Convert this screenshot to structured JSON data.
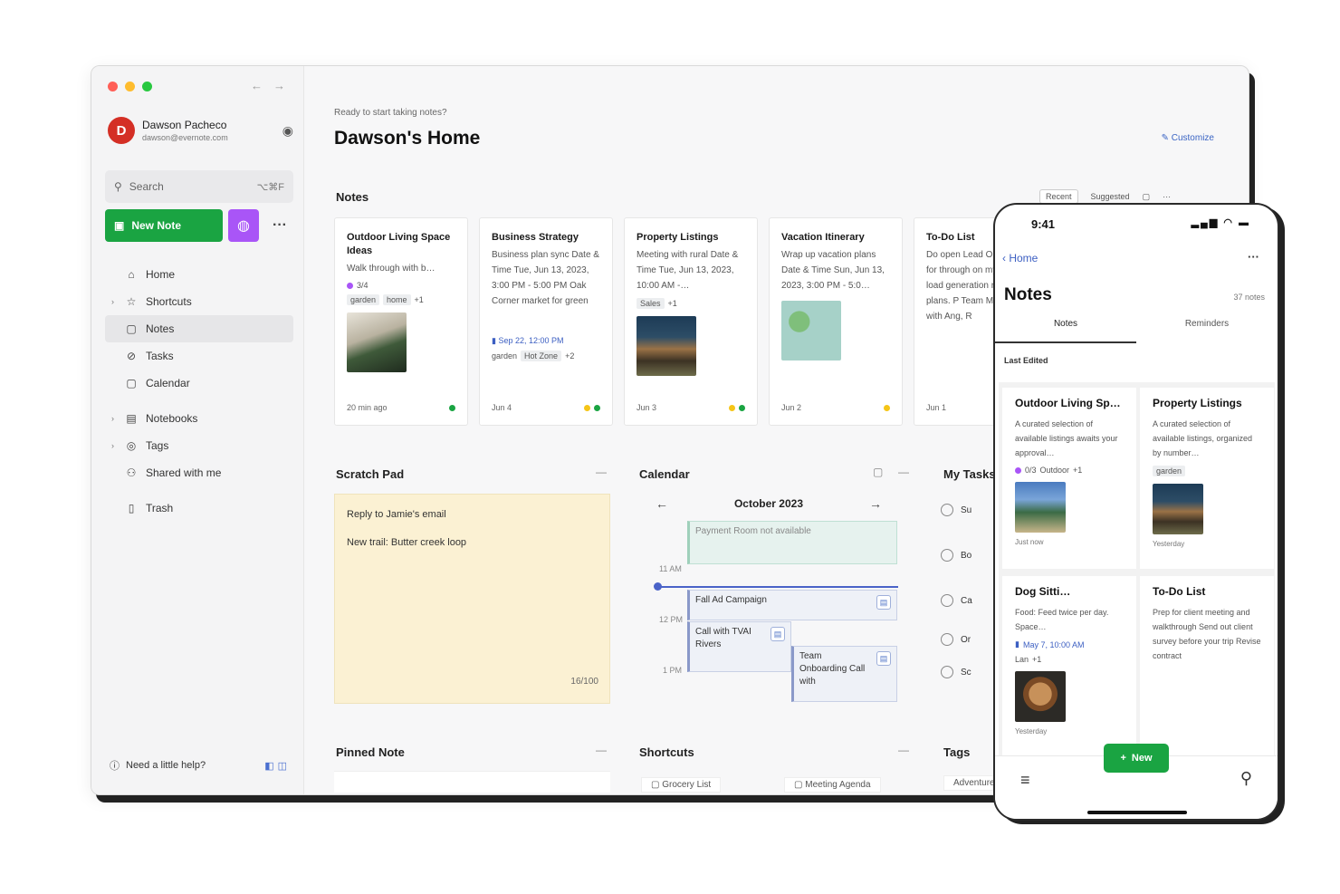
{
  "window": {
    "account_name": "Dawson Pacheco",
    "account_email": "dawson@evernote.com",
    "search_placeholder": "Search",
    "search_shortcut": "⌥⌘F",
    "new_note_label": "New Note",
    "nav": [
      {
        "label": "Home",
        "icon": "home-icon"
      },
      {
        "label": "Shortcuts",
        "icon": "star-icon"
      },
      {
        "label": "Notes",
        "icon": "note-icon"
      },
      {
        "label": "Tasks",
        "icon": "check-circle-icon"
      },
      {
        "label": "Calendar",
        "icon": "calendar-icon"
      },
      {
        "label": "Notebooks",
        "icon": "notebook-icon"
      },
      {
        "label": "Tags",
        "icon": "tag-icon"
      },
      {
        "label": "Shared with me",
        "icon": "people-icon"
      },
      {
        "label": "Trash",
        "icon": "trash-icon"
      }
    ],
    "help_label": "Need a little help?"
  },
  "home": {
    "greeting": "Ready to start taking notes?",
    "title": "Dawson's Home",
    "customize": "Customize",
    "notes_heading": "Notes",
    "notes_tools": [
      "Recent",
      "Suggested"
    ],
    "scratch_heading": "Scratch Pad",
    "calendar_heading": "Calendar",
    "tasks_heading": "My Tasks",
    "pinned_heading": "Pinned Note",
    "shortcuts_heading": "Shortcuts",
    "tags_heading": "Tags",
    "tags_first": "Adventure"
  },
  "notes": [
    {
      "title": "Outdoor Living Space Ideas",
      "body": "Walk through with b…",
      "tag_label": "3/4",
      "tags": [
        "garden",
        "home"
      ],
      "more": "+1",
      "date": "20 min ago"
    },
    {
      "title": "Business Strategy",
      "body": "Business plan sync Date & Time Tue, Jun 13, 2023, 3:00 PM - 5:00 PM Oak Corner market for green",
      "reminder": "Sep 22, 12:00 PM",
      "tags": [
        "garden",
        "Hot Zone"
      ],
      "more": "+2",
      "date": "Jun 4"
    },
    {
      "title": "Property Listings",
      "body": "Meeting with rural Date & Time Tue, Jun 13, 2023, 10:00 AM -…",
      "tags": [
        "Sales"
      ],
      "more": "+1",
      "date": "Jun 3"
    },
    {
      "title": "Vacation Itinerary",
      "body": "Wrap up vacation plans Date & Time Sun, Jun 13, 2023, 3:00 PM - 5:0…",
      "date": "Jun 2"
    },
    {
      "title": "To-Do List",
      "body": "Do open Lead Orientation for through on my writing load generation re and plans. P Team Meeting in with Ang, R",
      "date": "Jun 1"
    }
  ],
  "scratch": {
    "lines": [
      "Reply to Jamie's email",
      "New trail: Butter creek loop"
    ],
    "count": "16/100"
  },
  "calendar": {
    "month": "October 2023",
    "events": [
      "Payment Room not available",
      "Fall Ad Campaign",
      "Call with TVAI Rivers",
      "Team Onboarding Call with"
    ],
    "times": [
      "11 AM",
      "12 PM",
      "1 PM"
    ]
  },
  "tasks": [
    "Su",
    "Bo",
    "Ca",
    "Or",
    "Sc"
  ],
  "shortcuts": [
    "Grocery List",
    "Meeting Agenda"
  ],
  "phone": {
    "time": "9:41",
    "back": "Home",
    "title": "Notes",
    "count": "37 notes",
    "tabs": [
      "Notes",
      "Reminders"
    ],
    "sort": "Last Edited",
    "new_label": "New",
    "cards": [
      {
        "title": "Outdoor Living Sp…",
        "body": "A curated selection of available listings awaits your approval…",
        "tag": "0/3",
        "tag2": "Outdoor",
        "more": "+1",
        "date": "Just now"
      },
      {
        "title": "Property Listings",
        "body": "A curated selection of available listings, organized by number…",
        "tag2": "garden",
        "date": "Yesterday"
      },
      {
        "title": "Dog Sitti…",
        "body": "Food: Feed twice per day. Space…",
        "reminder": "May 7, 10:00 AM",
        "tag2": "Lan",
        "more": "+1",
        "date": "Yesterday"
      },
      {
        "title": "To-Do List",
        "body": "Prep for client meeting and walkthrough Send out client survey before your trip Revise contract",
        "date": "Yesterday"
      }
    ]
  },
  "colors": {
    "brand_green": "#1aa442",
    "ai_purple": "#a955f7",
    "avatar_red": "#d42f25",
    "link_blue": "#3c5fc2"
  }
}
